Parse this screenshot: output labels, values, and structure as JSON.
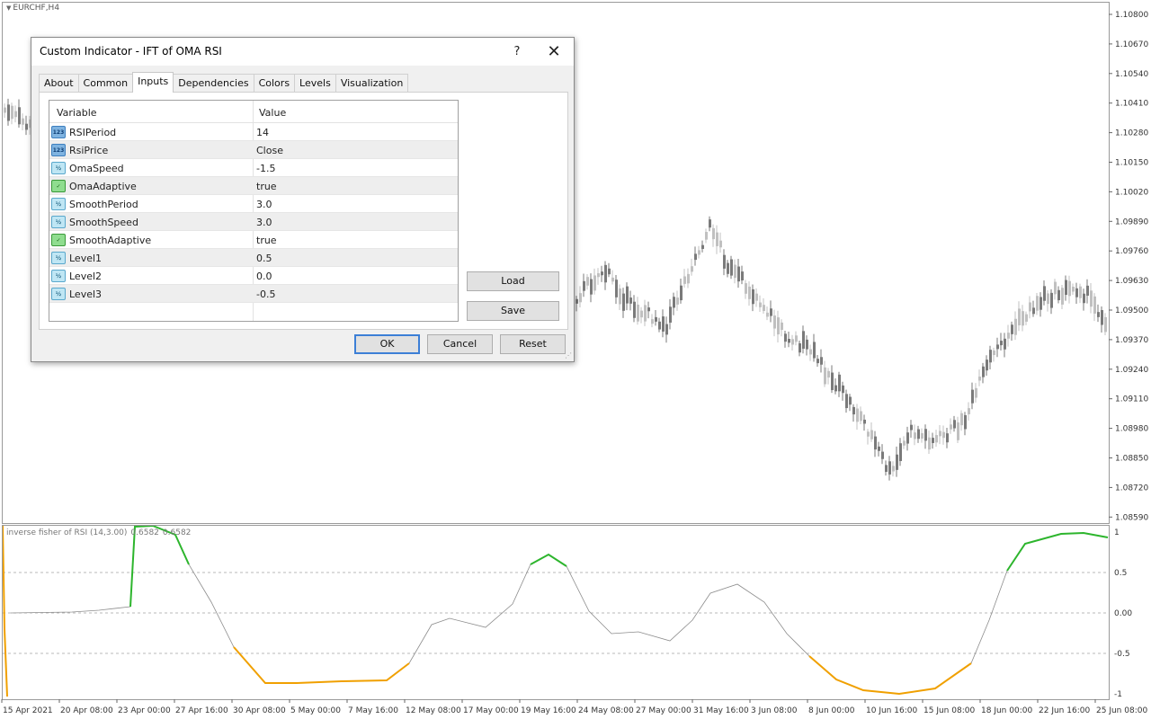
{
  "chart": {
    "symbol": "EURCHF,H4",
    "price_axis": [
      "1.10800",
      "1.10670",
      "1.10540",
      "1.10410",
      "1.10280",
      "1.10150",
      "1.10020",
      "1.09890",
      "1.09760",
      "1.09630",
      "1.09500",
      "1.09370",
      "1.09240",
      "1.09110",
      "1.08980",
      "1.08850",
      "1.08720",
      "1.08590"
    ],
    "time_axis": [
      "15 Apr 2021",
      "20 Apr 08:00",
      "23 Apr 00:00",
      "27 Apr 16:00",
      "30 Apr 08:00",
      "5 May 00:00",
      "7 May 16:00",
      "12 May 08:00",
      "17 May 00:00",
      "19 May 16:00",
      "24 May 08:00",
      "27 May 00:00",
      "31 May 16:00",
      "3 Jun 08:00",
      "8 Jun 00:00",
      "10 Jun 16:00",
      "15 Jun 08:00",
      "18 Jun 00:00",
      "22 Jun 16:00",
      "25 Jun 08:00"
    ],
    "colors": {
      "bull": "#c0c0c0",
      "bear": "#7a7a7a",
      "grid": "#bdbdbd"
    }
  },
  "indicator": {
    "label": "inverse fisher of RSI (14,3.00)",
    "value1": "0.6582",
    "value2": "0.6582",
    "levels_axis": [
      "1",
      "0.5",
      "0.00",
      "-0.5",
      "-1"
    ],
    "colors": {
      "up": "#2db52d",
      "down": "#f0a000",
      "neutral": "#8c8c8c",
      "level": "#b8b8b8"
    }
  },
  "dialog": {
    "title": "Custom Indicator - IFT of OMA RSI",
    "help": "?",
    "close": "✕",
    "tabs": [
      "About",
      "Common",
      "Inputs",
      "Dependencies",
      "Colors",
      "Levels",
      "Visualization"
    ],
    "active_tab": "Inputs",
    "headers": {
      "variable": "Variable",
      "value": "Value"
    },
    "inputs": [
      {
        "icon": "123",
        "kind": "num",
        "name": "RSIPeriod",
        "value": "14"
      },
      {
        "icon": "123",
        "kind": "num",
        "name": "RsiPrice",
        "value": "Close"
      },
      {
        "icon": "½",
        "kind": "dbl",
        "name": "OmaSpeed",
        "value": "-1.5"
      },
      {
        "icon": "✓",
        "kind": "bool",
        "name": "OmaAdaptive",
        "value": "true"
      },
      {
        "icon": "½",
        "kind": "dbl",
        "name": "SmoothPeriod",
        "value": "3.0"
      },
      {
        "icon": "½",
        "kind": "dbl",
        "name": "SmoothSpeed",
        "value": "3.0"
      },
      {
        "icon": "✓",
        "kind": "bool",
        "name": "SmoothAdaptive",
        "value": "true"
      },
      {
        "icon": "½",
        "kind": "dbl",
        "name": "Level1",
        "value": "0.5"
      },
      {
        "icon": "½",
        "kind": "dbl",
        "name": "Level2",
        "value": "0.0"
      },
      {
        "icon": "½",
        "kind": "dbl",
        "name": "Level3",
        "value": "-0.5"
      }
    ],
    "buttons": {
      "load": "Load",
      "save": "Save",
      "ok": "OK",
      "cancel": "Cancel",
      "reset": "Reset"
    }
  }
}
